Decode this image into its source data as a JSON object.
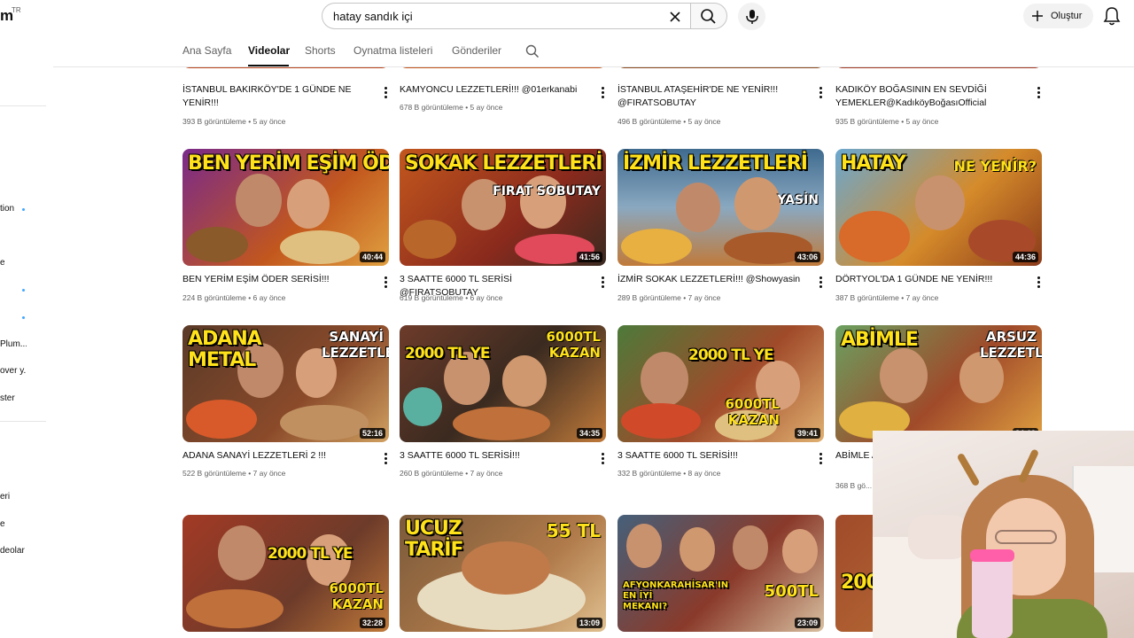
{
  "header": {
    "logo_fragment": "m",
    "country_code": "TR",
    "search_query": "hatay sandık içi",
    "create_label": "Oluştur"
  },
  "sidebar": {
    "items": [
      "tion",
      "e",
      "Plum...",
      "over y...",
      "ster",
      "eri",
      "e",
      "deolar"
    ]
  },
  "tabs": [
    {
      "label": "Ana Sayfa",
      "active": false
    },
    {
      "label": "Videolar",
      "active": true
    },
    {
      "label": "Shorts",
      "active": false
    },
    {
      "label": "Oynatma listeleri",
      "active": false
    },
    {
      "label": "Gönderiler",
      "active": false
    }
  ],
  "videos": {
    "row0": [
      {
        "title": "İSTANBUL BAKIRKÖY'DE 1 GÜNDE NE YENİR!!!",
        "views": "393 B görüntüleme",
        "age": "5 ay önce"
      },
      {
        "title": "KAMYONCU LEZZETLERİ!!! @01erkanabi",
        "views": "678 B görüntüleme",
        "age": "5 ay önce"
      },
      {
        "title": "İSTANBUL ATAŞEHİR'DE NE YENİR!!! @FIRATSOBUTAY",
        "views": "496 B görüntüleme",
        "age": "5 ay önce"
      },
      {
        "title": "KADIKÖY BOĞASININ EN SEVDİĞİ YEMEKLER@KadıköyBoğasıOfficial",
        "views": "935 B görüntüleme",
        "age": "5 ay önce"
      }
    ],
    "row1": [
      {
        "title": "BEN YERİM EŞİM ÖDER SERİSİ!!!",
        "views": "224 B görüntüleme",
        "age": "6 ay önce",
        "duration": "40:44",
        "thumb_text": "BEN YERİM EŞİM ÖDER",
        "thumb_sub": ""
      },
      {
        "title": "3 SAATTE 6000 TL SERİSİ @FIRATSOBUTAY",
        "views": "619 B görüntüleme",
        "age": "6 ay önce",
        "duration": "41:56",
        "thumb_text": "SOKAK LEZZETLERİ",
        "thumb_sub": "FIRAT SOBUTAY"
      },
      {
        "title": "İZMİR SOKAK LEZZETLERİ!!! @Showyasin",
        "views": "289 B görüntüleme",
        "age": "7 ay önce",
        "duration": "43:06",
        "thumb_text": "İZMİR LEZZETLERİ",
        "thumb_sub": "YASİN"
      },
      {
        "title": "DÖRTYOL'DA 1 GÜNDE NE YENİR!!!",
        "views": "387 B görüntüleme",
        "age": "7 ay önce",
        "duration": "44:36",
        "thumb_text": "HATAY",
        "thumb_sub": "NE YENİR?"
      }
    ],
    "row2": [
      {
        "title": "ADANA SANAYİ LEZZETLERİ 2 !!!",
        "views": "522 B görüntüleme",
        "age": "7 ay önce",
        "duration": "52:16",
        "thumb_text": "ADANA METAL",
        "thumb_sub": "SANAYİ LEZZETLERİ"
      },
      {
        "title": "3 SAATTE 6000 TL SERİSİ!!!",
        "views": "260 B görüntüleme",
        "age": "7 ay önce",
        "duration": "34:35",
        "thumb_text": "2000 TL YE",
        "thumb_sub": "6000TL KAZAN"
      },
      {
        "title": "3 SAATTE 6000 TL SERİSİ!!!",
        "views": "332 B görüntüleme",
        "age": "8 ay önce",
        "duration": "39:41",
        "thumb_text": "2000 TL YE",
        "thumb_sub": "6000TL KAZAN"
      },
      {
        "title": "ABİMLE A... @ilkerbil...",
        "views": "368 B gö...",
        "age": "",
        "duration": "34:19",
        "thumb_text": "ABİMLE",
        "thumb_sub": "ARSUZ LEZZETLERİ"
      }
    ],
    "row3": [
      {
        "duration": "32:28",
        "thumb_text": "2000 TL YE",
        "thumb_sub": "6000TL KAZAN"
      },
      {
        "duration": "13:09",
        "thumb_text": "UCUZ TARİF",
        "thumb_sub": "55 TL"
      },
      {
        "duration": "23:09",
        "thumb_text": "AFYONKARAHİSAR'IN EN İYİ MEKANI?",
        "thumb_sub": "500TL"
      },
      {
        "duration": "",
        "thumb_text": "2000",
        "thumb_sub": ""
      }
    ]
  },
  "colors": {
    "thumb_bg": [
      "#b9461f",
      "#c2571d",
      "#3f6b8f",
      "#d58b2a",
      "#8a2a1d",
      "#5a3a28",
      "#6d3b2a",
      "#4d7a3a",
      "#a23a25",
      "#7b5a3a",
      "#45607a",
      "#a04a2a"
    ],
    "accent_yellow": "#ffe21a"
  }
}
